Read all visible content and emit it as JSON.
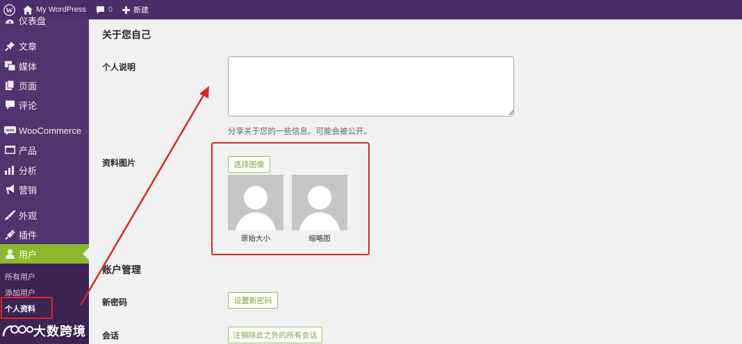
{
  "adminbar": {
    "site_name": "My WordPress",
    "comments_count": "0",
    "new_label": "新建"
  },
  "sidebar": {
    "items": [
      {
        "label": "仪表盘",
        "icon": "dashboard-icon"
      },
      {
        "label": "文章",
        "icon": "pin-icon"
      },
      {
        "label": "媒体",
        "icon": "media-icon"
      },
      {
        "label": "页面",
        "icon": "page-icon"
      },
      {
        "label": "评论",
        "icon": "comment-icon"
      },
      {
        "label": "WooCommerce",
        "icon": "woo-icon"
      },
      {
        "label": "产品",
        "icon": "product-icon"
      },
      {
        "label": "分析",
        "icon": "analytics-icon"
      },
      {
        "label": "营销",
        "icon": "megaphone-icon"
      },
      {
        "label": "外观",
        "icon": "brush-icon"
      },
      {
        "label": "插件",
        "icon": "plugin-icon"
      },
      {
        "label": "用户",
        "icon": "user-icon"
      }
    ],
    "submenu": [
      {
        "label": "所有用户"
      },
      {
        "label": "添加用户"
      },
      {
        "label": "个人资料"
      }
    ]
  },
  "content": {
    "about_title": "关于您自己",
    "bio_label": "个人说明",
    "bio_value": "",
    "bio_description": "分享关于您的一些信息。可能会被公开。",
    "picture_label": "资料图片",
    "choose_image_button": "选择图像",
    "avatar_original_caption": "原始大小",
    "avatar_thumb_caption": "缩略图",
    "account_title": "账户管理",
    "new_password_label": "新密码",
    "set_password_button": "设置新密码",
    "sessions_label": "会话",
    "logout_sessions_button": "注销除此之外的所有会话"
  },
  "watermark": {
    "text": "大数跨境"
  },
  "colors": {
    "adminbar_bg": "#4b2d6b",
    "sidebar_bg": "#50346f",
    "submenu_bg": "#3d2453",
    "active_green": "#8cb82b",
    "annotation_red": "#e02424"
  }
}
